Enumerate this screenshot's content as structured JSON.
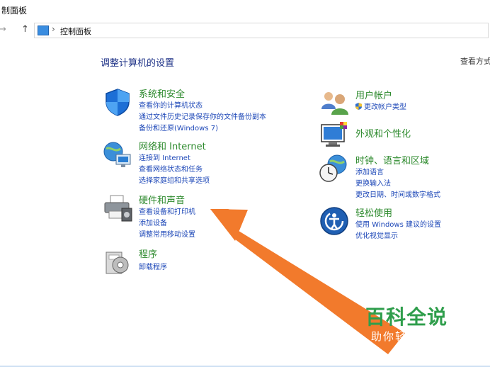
{
  "window": {
    "title": "制面板"
  },
  "address": {
    "path": "控制面板"
  },
  "heading": "调整计算机的设置",
  "view_by": "查看方式",
  "categories_left": [
    {
      "title": "系统和安全",
      "icon": "shield-icon",
      "links": [
        "查看你的计算机状态",
        "通过文件历史记录保存你的文件备份副本",
        "备份和还原(Windows 7)"
      ]
    },
    {
      "title": "网络和 Internet",
      "icon": "network-globe-icon",
      "links": [
        "连接到 Internet",
        "查看网络状态和任务",
        "选择家庭组和共享选项"
      ]
    },
    {
      "title": "硬件和声音",
      "icon": "printer-icon",
      "links": [
        "查看设备和打印机",
        "添加设备",
        "调整常用移动设置"
      ]
    },
    {
      "title": "程序",
      "icon": "programs-icon",
      "links": [
        "卸载程序"
      ]
    }
  ],
  "categories_right": [
    {
      "title": "用户帐户",
      "icon": "users-icon",
      "links": [
        "更改帐户类型"
      ]
    },
    {
      "title": "外观和个性化",
      "icon": "monitor-palette-icon",
      "links": []
    },
    {
      "title": "时钟、语言和区域",
      "icon": "clock-globe-icon",
      "links": [
        "添加语言",
        "更换输入法",
        "更改日期、时间或数字格式"
      ]
    },
    {
      "title": "轻松使用",
      "icon": "ease-of-access-icon",
      "links": [
        "使用 Windows 建议的设置",
        "优化视觉显示"
      ]
    }
  ],
  "watermark": {
    "title": "百科全说",
    "subtitle": "助你轻松解决"
  },
  "colors": {
    "link": "#1e48b8",
    "category_title": "#2d8a2d",
    "heading": "#1e3287",
    "arrow": "#f27a2c",
    "watermark_green": "#2f9e4c"
  }
}
